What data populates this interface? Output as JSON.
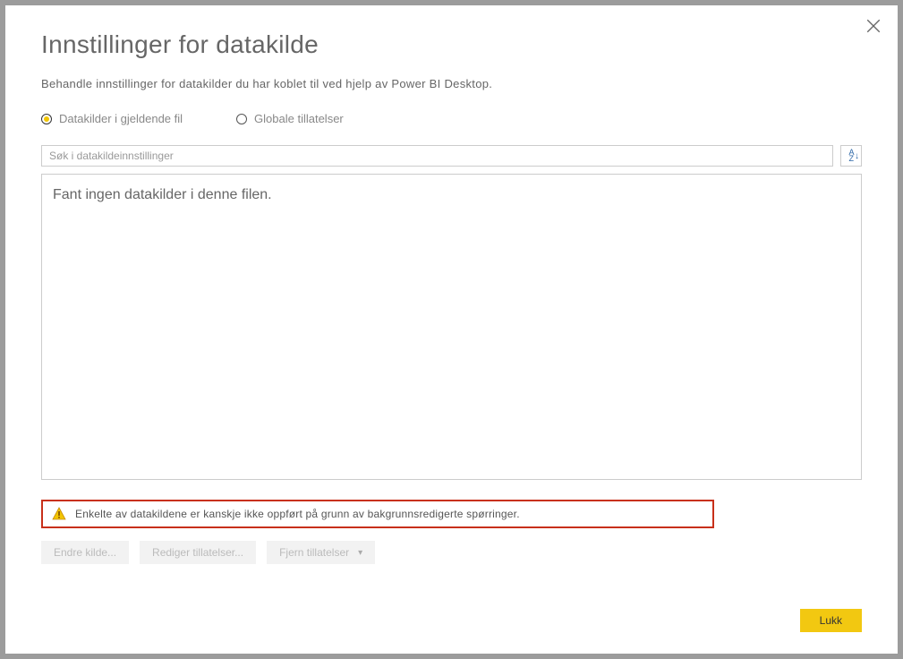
{
  "dialog": {
    "title": "Innstillinger for datakilde",
    "subtitle": "Behandle innstillinger for datakilder du har koblet til ved hjelp av Power BI Desktop."
  },
  "radios": {
    "current_file": "Datakilder i gjeldende fil",
    "global": "Globale tillatelser"
  },
  "search": {
    "placeholder": "Søk i datakildeinnstillinger"
  },
  "list": {
    "empty_message": "Fant ingen datakilder i denne filen."
  },
  "warning": {
    "text": "Enkelte av datakildene er kanskje ikke oppført på grunn av bakgrunnsredigerte spørringer."
  },
  "buttons": {
    "change_source": "Endre kilde...",
    "edit_permissions": "Rediger tillatelser...",
    "clear_permissions": "Fjern tillatelser",
    "close": "Lukk"
  }
}
